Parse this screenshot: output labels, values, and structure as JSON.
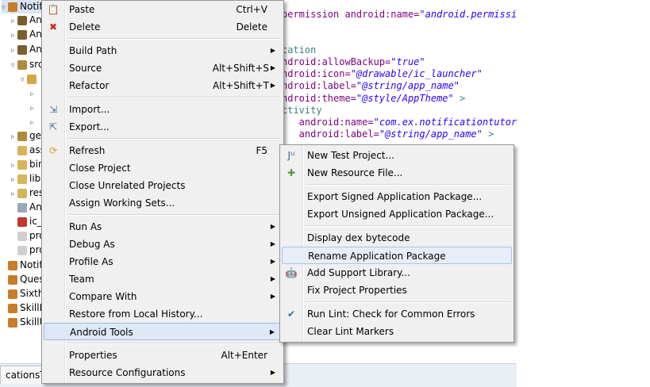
{
  "tree": {
    "items": [
      {
        "text": "Notific",
        "indent": 0,
        "twisty": "▿",
        "color": "#c77d2a"
      },
      {
        "text": "An",
        "indent": 1,
        "twisty": "▹",
        "color": "#7a5f2c"
      },
      {
        "text": "An",
        "indent": 1,
        "twisty": "▹",
        "color": "#7a5f2c"
      },
      {
        "text": "An",
        "indent": 1,
        "twisty": "▹",
        "color": "#7a5f2c"
      },
      {
        "text": "src",
        "indent": 1,
        "twisty": "▿",
        "color": "#b08a3c"
      },
      {
        "text": "",
        "indent": 2,
        "twisty": "▿",
        "color": "#d8a640"
      },
      {
        "text": "",
        "indent": 3,
        "twisty": "▹",
        "color": ""
      },
      {
        "text": "",
        "indent": 3,
        "twisty": "▹",
        "color": ""
      },
      {
        "text": "",
        "indent": 3,
        "twisty": "▹",
        "color": ""
      },
      {
        "text": "ge",
        "indent": 1,
        "twisty": "▹",
        "color": "#b08a3c"
      },
      {
        "text": "ass",
        "indent": 1,
        "twisty": "",
        "color": "#d8b35a"
      },
      {
        "text": "bin",
        "indent": 1,
        "twisty": "▹",
        "color": "#d8b35a"
      },
      {
        "text": "lib",
        "indent": 1,
        "twisty": "▹",
        "color": "#d8b35a"
      },
      {
        "text": "res",
        "indent": 1,
        "twisty": "▹",
        "color": "#d8b35a"
      },
      {
        "text": "An",
        "indent": 1,
        "twisty": "",
        "color": "#9aa8b8"
      },
      {
        "text": "ic_",
        "indent": 1,
        "twisty": "",
        "color": "#c0392b"
      },
      {
        "text": "pro",
        "indent": 1,
        "twisty": "",
        "color": "#cfcfcf"
      },
      {
        "text": "pro",
        "indent": 1,
        "twisty": "",
        "color": "#cfcfcf"
      },
      {
        "text": "Notify",
        "indent": 0,
        "twisty": "",
        "color": "#c77d2a"
      },
      {
        "text": "Quest",
        "indent": 0,
        "twisty": "",
        "color": "#c77d2a"
      },
      {
        "text": "Sixth_",
        "indent": 0,
        "twisty": "",
        "color": "#c77d2a"
      },
      {
        "text": "SkillPr",
        "indent": 0,
        "twisty": "",
        "color": "#c77d2a"
      },
      {
        "text": "SkillUp",
        "indent": 0,
        "twisty": "",
        "color": "#c77d2a"
      }
    ]
  },
  "editor": {
    "lines": [
      {
        "parts": [
          [
            "attr",
            "permission "
          ],
          [
            "attr",
            "android:name="
          ],
          [
            "val",
            "\"android.permissio"
          ]
        ]
      },
      {
        "parts": []
      },
      {
        "parts": [
          [
            "tag",
            "cation"
          ]
        ]
      },
      {
        "parts": [
          [
            "attr",
            "ndroid:allowBackup="
          ],
          [
            "val",
            "\"true\""
          ]
        ]
      },
      {
        "parts": [
          [
            "attr",
            "ndroid:icon="
          ],
          [
            "val",
            "\"@drawable/ic_launcher\""
          ]
        ]
      },
      {
        "parts": [
          [
            "attr",
            "ndroid:label="
          ],
          [
            "val",
            "\"@string/app_name\""
          ]
        ]
      },
      {
        "parts": [
          [
            "attr",
            "ndroid:theme="
          ],
          [
            "val",
            "\"@style/AppTheme\""
          ],
          [
            "tag",
            " >"
          ]
        ]
      },
      {
        "parts": [
          [
            "tag",
            "ctivity"
          ]
        ]
      },
      {
        "parts": [
          [
            "attr",
            "   android:name="
          ],
          [
            "val",
            "\"com.ex.notificationtutori"
          ]
        ]
      },
      {
        "parts": [
          [
            "attr",
            "   android:label="
          ],
          [
            "val",
            "\"@string/app_name\""
          ],
          [
            "tag",
            " >"
          ]
        ]
      }
    ]
  },
  "bottom_tab": "cationsTut",
  "context_menu": {
    "items": [
      {
        "type": "item",
        "label": "Paste",
        "shortcut": "Ctrl+V",
        "icon": "paste-icon",
        "glyph": "📋",
        "arrow": false
      },
      {
        "type": "item",
        "label": "Delete",
        "shortcut": "Delete",
        "icon": "delete-icon",
        "glyph": "✖",
        "glyph_color": "#d0281e",
        "arrow": false
      },
      {
        "type": "sep"
      },
      {
        "type": "item",
        "label": "Build Path",
        "shortcut": "",
        "arrow": true
      },
      {
        "type": "item",
        "label": "Source",
        "shortcut": "Alt+Shift+S",
        "arrow": true
      },
      {
        "type": "item",
        "label": "Refactor",
        "shortcut": "Alt+Shift+T",
        "arrow": true
      },
      {
        "type": "sep"
      },
      {
        "type": "item",
        "label": "Import...",
        "shortcut": "",
        "icon": "import-icon",
        "glyph": "⇲",
        "glyph_color": "#4a6b9a",
        "arrow": false
      },
      {
        "type": "item",
        "label": "Export...",
        "shortcut": "",
        "icon": "export-icon",
        "glyph": "⇱",
        "glyph_color": "#4a6b9a",
        "arrow": false
      },
      {
        "type": "sep"
      },
      {
        "type": "item",
        "label": "Refresh",
        "shortcut": "F5",
        "icon": "refresh-icon",
        "glyph": "⟳",
        "glyph_color": "#d8a020",
        "arrow": false
      },
      {
        "type": "item",
        "label": "Close Project",
        "shortcut": "",
        "arrow": false
      },
      {
        "type": "item",
        "label": "Close Unrelated Projects",
        "shortcut": "",
        "arrow": false
      },
      {
        "type": "item",
        "label": "Assign Working Sets...",
        "shortcut": "",
        "arrow": false
      },
      {
        "type": "sep"
      },
      {
        "type": "item",
        "label": "Run As",
        "shortcut": "",
        "arrow": true
      },
      {
        "type": "item",
        "label": "Debug As",
        "shortcut": "",
        "arrow": true
      },
      {
        "type": "item",
        "label": "Profile As",
        "shortcut": "",
        "arrow": true
      },
      {
        "type": "item",
        "label": "Team",
        "shortcut": "",
        "arrow": true
      },
      {
        "type": "item",
        "label": "Compare With",
        "shortcut": "",
        "arrow": true
      },
      {
        "type": "item",
        "label": "Restore from Local History...",
        "shortcut": "",
        "arrow": false
      },
      {
        "type": "item",
        "label": "Android Tools",
        "shortcut": "",
        "arrow": true,
        "active": true
      },
      {
        "type": "sep"
      },
      {
        "type": "item",
        "label": "Properties",
        "shortcut": "Alt+Enter",
        "arrow": false
      },
      {
        "type": "item",
        "label": "Resource Configurations",
        "shortcut": "",
        "arrow": true
      }
    ]
  },
  "submenu": {
    "items": [
      {
        "type": "item",
        "label": "New Test Project...",
        "icon": "junit-project-icon",
        "glyph": "Jᵁ",
        "glyph_color": "#3a5f9e"
      },
      {
        "type": "item",
        "label": "New Resource File...",
        "icon": "new-resource-icon",
        "glyph": "✚",
        "glyph_color": "#5a9a3a"
      },
      {
        "type": "sep"
      },
      {
        "type": "item",
        "label": "Export Signed Application Package..."
      },
      {
        "type": "item",
        "label": "Export Unsigned Application Package..."
      },
      {
        "type": "sep"
      },
      {
        "type": "item",
        "label": "Display dex bytecode"
      },
      {
        "type": "item",
        "label": "Rename Application Package",
        "hover": true
      },
      {
        "type": "item",
        "label": "Add Support Library...",
        "icon": "android-icon",
        "glyph": "🤖",
        "glyph_color": "#8ab832"
      },
      {
        "type": "item",
        "label": "Fix Project Properties"
      },
      {
        "type": "sep"
      },
      {
        "type": "item",
        "label": "Run Lint: Check for Common Errors",
        "icon": "check-icon",
        "glyph": "✔",
        "glyph_color": "#2a6fb0"
      },
      {
        "type": "item",
        "label": "Clear Lint Markers"
      }
    ]
  },
  "colors": {
    "menu_bg": "#f0f0f0",
    "highlight": "#e8eef7",
    "accent": "#a8c4e8"
  }
}
